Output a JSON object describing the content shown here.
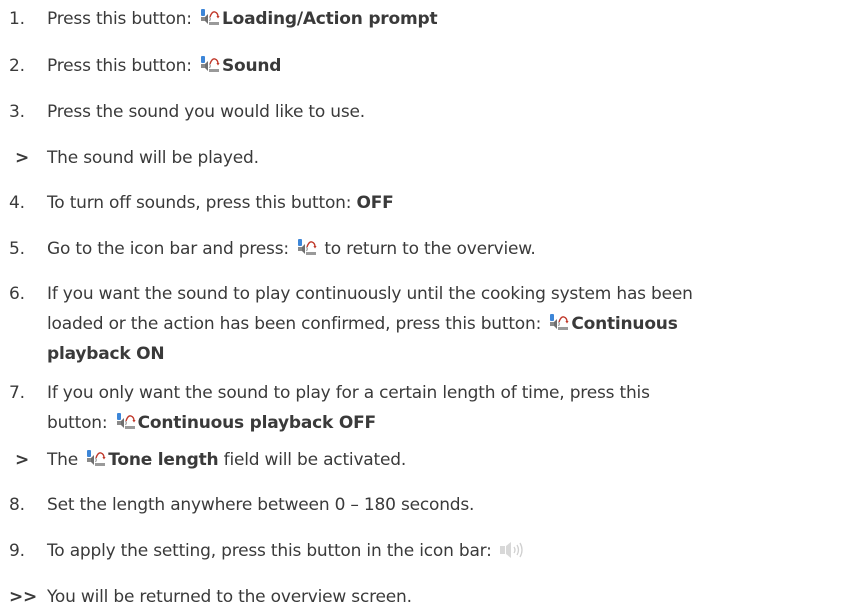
{
  "steps": [
    {
      "marker": "1.",
      "pre": "Press this button: ",
      "bold": "Loading/Action prompt"
    },
    {
      "marker": "2.",
      "pre": "Press this button: ",
      "bold": "Sound"
    },
    {
      "marker": "3.",
      "text": "Press the sound you would like to use."
    },
    {
      "marker": ">",
      "text": "The sound will be played."
    },
    {
      "marker": "4.",
      "pre": "To turn off sounds, press this button: ",
      "bold": "OFF"
    },
    {
      "marker": "5.",
      "pre": "Go to the icon bar and press: ",
      "post": " to return to the overview."
    },
    {
      "marker": "6.",
      "line1": "If you want the sound to play continuously until the cooking system has been",
      "line2pre": "loaded or the action has been confirmed, press this button: ",
      "bold1": "Continuous",
      "bold2": "playback ON"
    },
    {
      "marker": "7.",
      "line1": "If you only want the sound to play for a certain length of time, press this",
      "line2pre": "button: ",
      "bold": "Continuous playback OFF"
    },
    {
      "marker": ">",
      "pre": "The ",
      "bold": "Tone length",
      "post": " field will be activated."
    },
    {
      "marker": "8.",
      "text": "Set the length anywhere between 0 – 180 seconds."
    },
    {
      "marker": "9.",
      "text": "To apply the setting, press this button in the icon bar: "
    },
    {
      "marker": ">>",
      "text": "You will be returned to the overview screen."
    }
  ],
  "icons": {
    "button_icon": "speaker-bell-icon",
    "apply_icon": "speaker-icon",
    "accent": "#c0392b",
    "icon_blue": "#2f7fd6",
    "icon_gray": "#8a8a8a"
  }
}
